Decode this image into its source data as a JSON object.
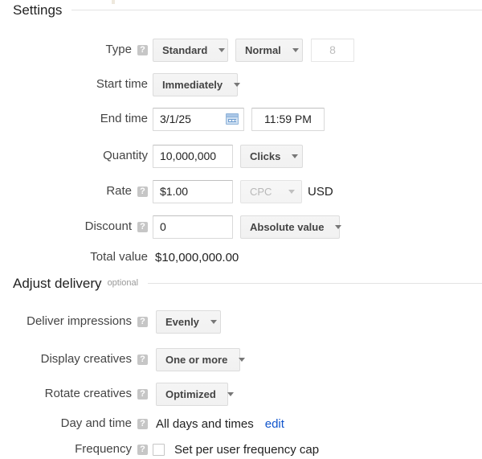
{
  "sections": {
    "settings": {
      "title": "Settings",
      "optional": ""
    },
    "adjust_delivery": {
      "title": "Adjust delivery",
      "optional": "optional"
    }
  },
  "settings_rows": {
    "type": {
      "label": "Type",
      "has_help": true,
      "type_select": "Standard",
      "priority_select": "Normal",
      "priority_value": "8"
    },
    "start_time": {
      "label": "Start time",
      "has_help": false,
      "value": "Immediately"
    },
    "end_time": {
      "label": "End time",
      "has_help": false,
      "date": "3/1/25",
      "time": "11:59 PM",
      "calendar_icon": "calendar-icon"
    },
    "quantity": {
      "label": "Quantity",
      "has_help": false,
      "value": "10,000,000",
      "unit_select": "Clicks"
    },
    "rate": {
      "label": "Rate",
      "has_help": true,
      "value": "$1.00",
      "basis_select": "CPC",
      "currency": "USD"
    },
    "discount": {
      "label": "Discount",
      "has_help": true,
      "value": "0",
      "mode_select": "Absolute value"
    },
    "total_value": {
      "label": "Total value",
      "has_help": false,
      "value": "$10,000,000.00"
    }
  },
  "delivery_rows": {
    "deliver_impressions": {
      "label": "Deliver impressions",
      "has_help": true,
      "value": "Evenly"
    },
    "display_creatives": {
      "label": "Display creatives",
      "has_help": true,
      "value": "One or more"
    },
    "rotate_creatives": {
      "label": "Rotate creatives",
      "has_help": true,
      "value": "Optimized"
    },
    "day_and_time": {
      "label": "Day and time",
      "has_help": true,
      "value": "All days and times",
      "edit_link": "edit"
    },
    "frequency": {
      "label": "Frequency",
      "has_help": true,
      "checkbox_label": "Set per user frequency cap",
      "checked": false
    }
  },
  "icons": {
    "help": "help-icon",
    "caret": "chevron-down-icon"
  },
  "colors": {
    "link": "#1155cc",
    "rule": "#e3e3e3",
    "help_bg": "#c6c6c6",
    "button_bg": "#f5f5f5",
    "text": "#222222"
  }
}
